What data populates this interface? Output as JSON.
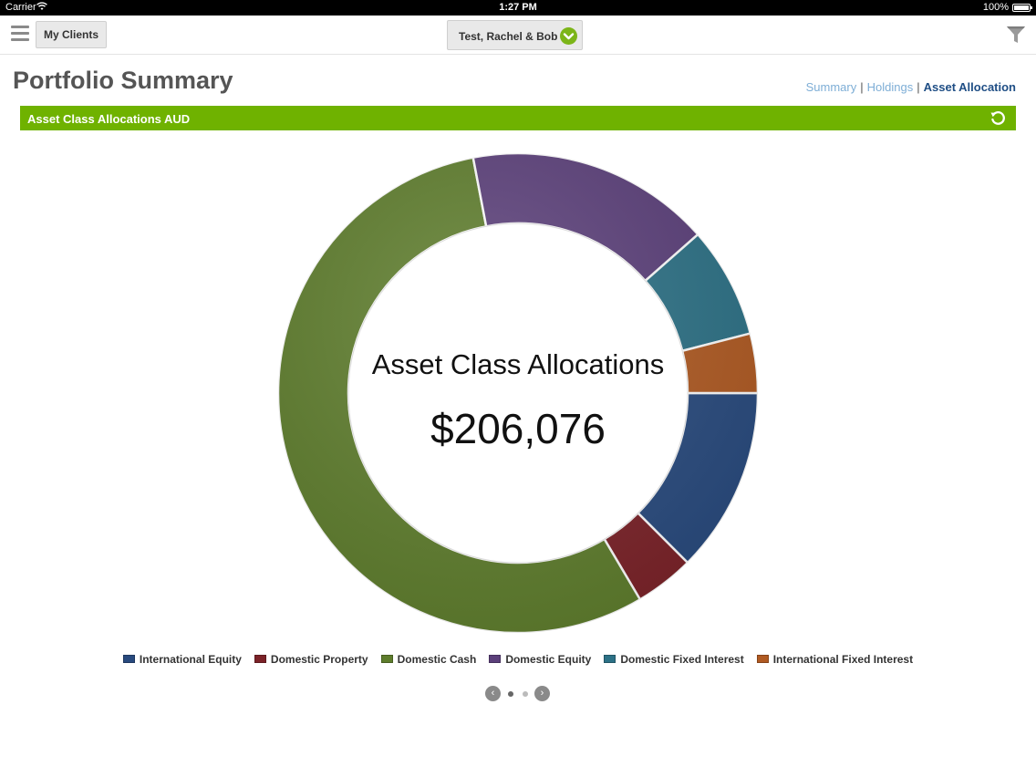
{
  "status_bar": {
    "carrier": "Carrier",
    "time": "1:27 PM",
    "battery": "100%"
  },
  "nav": {
    "my_clients_label": "My Clients",
    "client_name": "Test, Rachel & Bob"
  },
  "page": {
    "title": "Portfolio Summary",
    "links": [
      {
        "label": "Summary",
        "active": false
      },
      {
        "label": "Holdings",
        "active": false
      },
      {
        "label": "Asset Allocation",
        "active": true
      }
    ]
  },
  "section": {
    "title": "Asset Class Allocations AUD"
  },
  "chart_data": {
    "type": "pie",
    "center_title": "Asset Class Allocations",
    "center_value": "$206,076",
    "series": [
      {
        "name": "International Equity",
        "value": 12.5,
        "color": "#284a7e"
      },
      {
        "name": "Domestic Property",
        "value": 4.0,
        "color": "#7b2228"
      },
      {
        "name": "Domestic Cash",
        "value": 55.5,
        "color": "#5e7d2c"
      },
      {
        "name": "Domestic Equity",
        "value": 16.5,
        "color": "#5b3f7a"
      },
      {
        "name": "Domestic Fixed Interest",
        "value": 7.5,
        "color": "#2c7186"
      },
      {
        "name": "International Fixed Interest",
        "value": 4.0,
        "color": "#b05a22"
      }
    ]
  },
  "pager": {
    "prev": "‹",
    "next": "›"
  }
}
